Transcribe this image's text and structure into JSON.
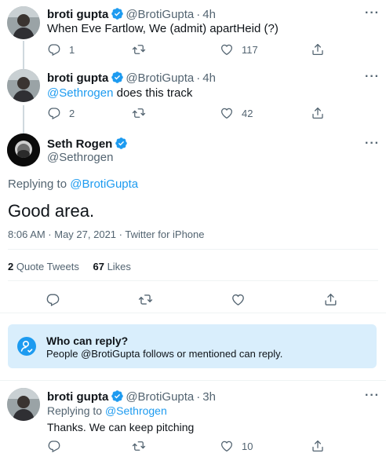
{
  "tweets": [
    {
      "name": "broti gupta",
      "handle": "@BrotiGupta",
      "time": "4h",
      "text": "When Eve Fartlow, We (admit) apartHeid (?)",
      "reply_count": "1",
      "retweet_count": "",
      "like_count": "117"
    },
    {
      "name": "broti gupta",
      "handle": "@BrotiGupta",
      "time": "4h",
      "mention": "@Sethrogen",
      "text": "does this track",
      "reply_count": "2",
      "retweet_count": "",
      "like_count": "42"
    }
  ],
  "main": {
    "name": "Seth Rogen",
    "handle": "@Sethrogen",
    "replying_prefix": "Replying to",
    "replying_to": "@BrotiGupta",
    "text": "Good area.",
    "meta": "8:06 AM · May 27, 2021 · Twitter for iPhone",
    "quote_count": "2",
    "quote_label": "Quote Tweets",
    "like_count": "67",
    "like_label": "Likes"
  },
  "who_can_reply": {
    "title": "Who can reply?",
    "body_prefix": "People",
    "body_mention": "@BrotiGupta",
    "body_suffix": "follows or mentioned can reply."
  },
  "reply": {
    "name": "broti gupta",
    "handle": "@BrotiGupta",
    "time": "3h",
    "replying_prefix": "Replying to",
    "replying_to": "@Sethrogen",
    "text": "Thanks. We can keep pitching",
    "reply_count": "",
    "retweet_count": "",
    "like_count": "10"
  },
  "icons": {
    "verified": "verified-badge-icon",
    "more": "more-dots-icon",
    "reply": "reply-icon",
    "retweet": "retweet-icon",
    "like": "heart-icon",
    "share": "share-icon",
    "who_can_reply": "person-icon"
  },
  "colors": {
    "accent": "#1d9bf0",
    "muted": "#536471",
    "text": "#0f1419",
    "callout_bg": "#d9eefc"
  },
  "separators": {
    "dot": "·",
    "more": "···"
  }
}
